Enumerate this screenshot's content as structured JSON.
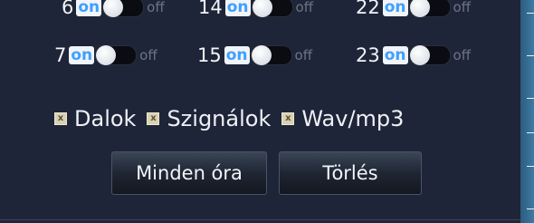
{
  "rows": [
    {
      "hours": [
        {
          "num": "6",
          "on": "on",
          "off": "off"
        },
        {
          "num": "14",
          "on": "on",
          "off": "off"
        },
        {
          "num": "22",
          "on": "on",
          "off": "off"
        }
      ]
    },
    {
      "hours": [
        {
          "num": "7",
          "on": "on",
          "off": "off"
        },
        {
          "num": "15",
          "on": "on",
          "off": "off"
        },
        {
          "num": "23",
          "on": "on",
          "off": "off"
        }
      ]
    }
  ],
  "checkboxes": [
    {
      "label": "Dalok",
      "mark": "x"
    },
    {
      "label": "Szignálok",
      "mark": "x"
    },
    {
      "label": "Wav/mp3",
      "mark": "x"
    }
  ],
  "buttons": {
    "every_hour": "Minden óra",
    "delete": "Törlés"
  },
  "colors": {
    "background": "#1e2538",
    "on_text": "#3ea0ff",
    "side_strip": "#3f7aa2"
  }
}
